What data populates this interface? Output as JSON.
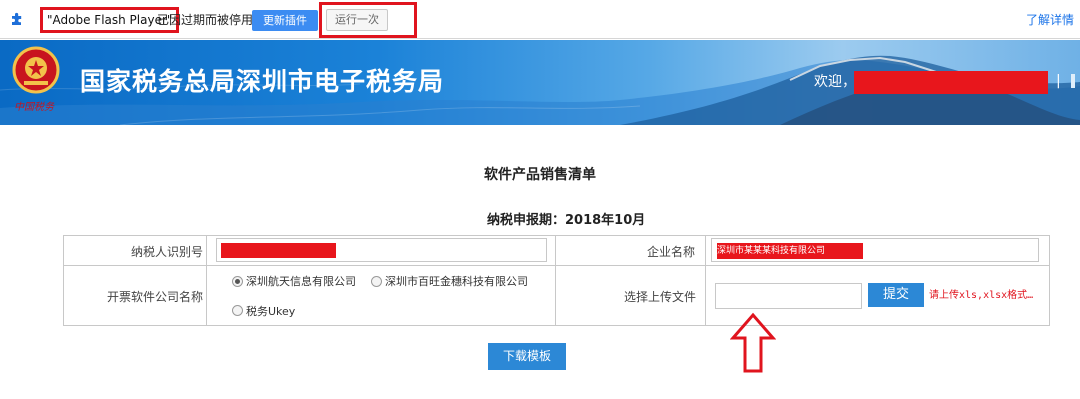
{
  "plugin_bar": {
    "icon": "puzzle-piece-icon",
    "plugin_name": "\"Adobe Flash Player\"",
    "message": "已因过期而被停用",
    "update_button": "更新插件",
    "run_once_button": "运行一次",
    "details_link": "了解详情",
    "link_color": "#1a73e8",
    "highlight_color": "#e0141e"
  },
  "header": {
    "emblem": "tax-emblem-icon",
    "emblem_text": "中国税务",
    "title": "国家税务总局深圳市电子税务局",
    "welcome": "欢迎，",
    "separator": "|",
    "brand_color": "#0a6ac4"
  },
  "content": {
    "title": "软件产品销售清单",
    "period": "纳税申报期：2018年10月",
    "fields": {
      "taxpayer_id_label": "纳税人识别号",
      "company_name_label": "企业名称",
      "company_name_value": "深圳市某某某科技有限公司",
      "software_company_label": "开票软件公司名称",
      "upload_label": "选择上传文件"
    },
    "radio_options": [
      {
        "label": "深圳航天信息有限公司",
        "checked": true
      },
      {
        "label": "深圳市百旺金穗科技有限公司",
        "checked": false
      },
      {
        "label": "税务Ukey",
        "checked": false
      }
    ],
    "submit_button": "提交",
    "upload_hint": "请上传xls,xlsx格式…",
    "download_button": "下载模板",
    "button_color": "#2c88d6",
    "annotation_arrow": "up-arrow-icon"
  }
}
